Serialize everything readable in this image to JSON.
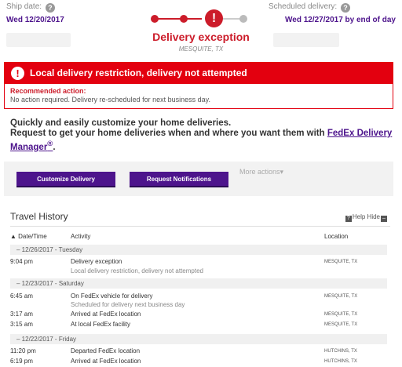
{
  "header": {
    "ship_label": "Ship date:",
    "ship_date": "Wed 12/20/2017",
    "scheduled_label": "Scheduled delivery:",
    "scheduled_date": "Wed 12/27/2017 by end of day",
    "help_glyph": "?"
  },
  "status": {
    "title": "Delivery exception",
    "location": "MESQUITE, TX",
    "exception_glyph": "!"
  },
  "alert": {
    "message": "Local delivery restriction, delivery not attempted",
    "glyph": "!"
  },
  "recommended": {
    "title": "Recommended action:",
    "text": "No action required. Delivery re-scheduled for next business day."
  },
  "promo": {
    "line1": "Quickly and easily customize your home deliveries.",
    "line2": "Request to get your home deliveries when and where you want them with ",
    "link": "FedEx Delivery Manager",
    "reg": "®",
    "end": "."
  },
  "actions": {
    "customize": "Customize Delivery",
    "notifications": "Request Notifications",
    "more": "More actions▾"
  },
  "travel_history": {
    "title": "Travel History",
    "help": "Help",
    "hide": "Hide",
    "help_icon": "?",
    "hide_icon": "–",
    "col_date": "▲ Date/Time",
    "col_activity": "Activity",
    "col_location": "Location",
    "groups": [
      {
        "date": "–     12/26/2017 - Tuesday"
      },
      {
        "date": "–     12/23/2017 - Saturday"
      },
      {
        "date": "–     12/22/2017 - Friday"
      }
    ],
    "rows": [
      {
        "time": "9:04 pm",
        "activity": "Delivery exception",
        "sub": "Local delivery restriction, delivery not attempted",
        "location": "MESQUITE, TX"
      },
      {
        "time": "6:45 am",
        "activity": "On FedEx vehicle for delivery",
        "sub": "Scheduled for delivery next business day",
        "location": "MESQUITE, TX"
      },
      {
        "time": "3:17 am",
        "activity": "Arrived at FedEx location",
        "sub": "",
        "location": "MESQUITE, TX"
      },
      {
        "time": "3:15 am",
        "activity": "At local FedEx facility",
        "sub": "",
        "location": "MESQUITE, TX"
      },
      {
        "time": "11:20 pm",
        "activity": "Departed FedEx location",
        "sub": "",
        "location": "HUTCHINS, TX"
      },
      {
        "time": "6:19 pm",
        "activity": "Arrived at FedEx location",
        "sub": "",
        "location": "HUTCHINS, TX"
      }
    ]
  },
  "colors": {
    "brand_purple": "#4d148c",
    "alert_red": "#e3000f",
    "exception_red": "#cc1c2a"
  }
}
